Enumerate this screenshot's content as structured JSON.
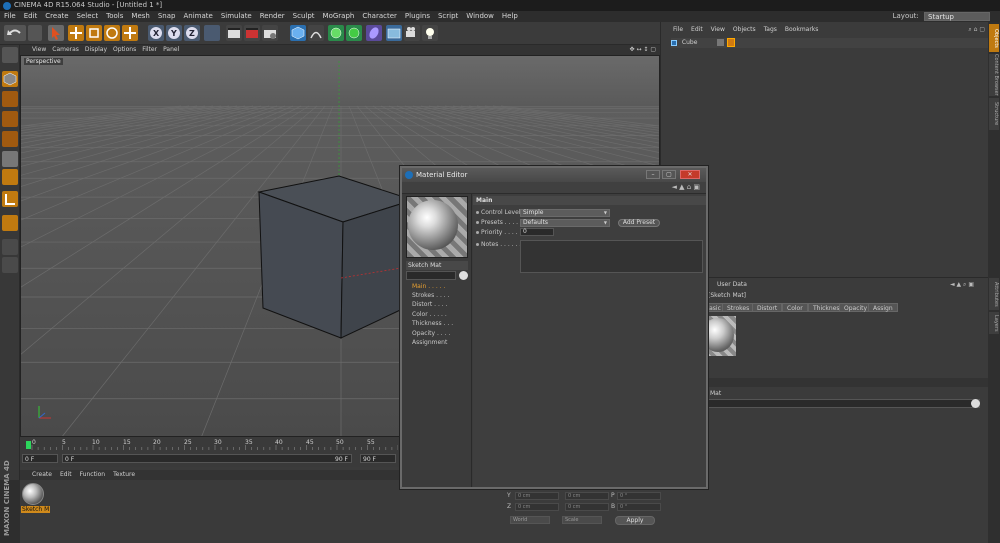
{
  "window": {
    "title": "CINEMA 4D R15.064 Studio - [Untitled 1 *]",
    "layout_label": "Layout:",
    "layout_value": "Startup"
  },
  "menubar": [
    "File",
    "Edit",
    "Create",
    "Select",
    "Tools",
    "Mesh",
    "Snap",
    "Animate",
    "Simulate",
    "Render",
    "Sculpt",
    "MoGraph",
    "Character",
    "Plugins",
    "Script",
    "Window",
    "Help"
  ],
  "viewport": {
    "menu": [
      "View",
      "Cameras",
      "Display",
      "Options",
      "Filter",
      "Panel"
    ],
    "label": "Perspective"
  },
  "timeline": {
    "ticks": [
      "0",
      "5",
      "10",
      "15",
      "20",
      "25",
      "30",
      "35",
      "40",
      "45",
      "50",
      "55"
    ],
    "start_field": "0 F",
    "current_field": "0 F",
    "end_field": "90 F",
    "end_field2": "90 F"
  },
  "material_manager": {
    "menu": [
      "Create",
      "Edit",
      "Function",
      "Texture"
    ],
    "material_name": "Sketch M"
  },
  "coordinates": {
    "rows": [
      {
        "axis": "Y",
        "pos": "0 cm",
        "size": "0 cm",
        "rot_axis": "P",
        "rot": "0 °"
      },
      {
        "axis": "Z",
        "pos": "0 cm",
        "size": "0 cm",
        "rot_axis": "B",
        "rot": "0 °"
      }
    ],
    "mode1": "World",
    "mode2": "Scale",
    "apply_label": "Apply"
  },
  "object_manager": {
    "menu": [
      "File",
      "Edit",
      "View",
      "Objects",
      "Tags",
      "Bookmarks"
    ],
    "object_name": "Cube"
  },
  "right_tabs": [
    "Objects",
    "Content Browser",
    "Structure",
    "Attributes",
    "Layers"
  ],
  "attribute_manager": {
    "header": "User Data",
    "subtitle": "[Sketch Mat]",
    "tabs": [
      "Basic",
      "Strokes",
      "Distort",
      "Color",
      "Thickness",
      "Opacity",
      "Assign"
    ],
    "mat_label": "Mat"
  },
  "material_editor": {
    "title": "Material Editor",
    "material_name": "Sketch Mat",
    "channels": [
      "Main . . . . .",
      "Strokes . . . .",
      "Distort . . . .",
      "Color . . . . .",
      "Thickness . . .",
      "Opacity . . . .",
      "Assignment"
    ],
    "section_title": "Main",
    "control_level_label": "Control Level",
    "control_level_value": "Simple",
    "presets_label": "Presets . . . .",
    "presets_value": "Defaults",
    "add_preset_label": "Add Preset",
    "priority_label": "Priority . . . . .",
    "priority_value": "0",
    "notes_label": "Notes . . . . . ."
  }
}
